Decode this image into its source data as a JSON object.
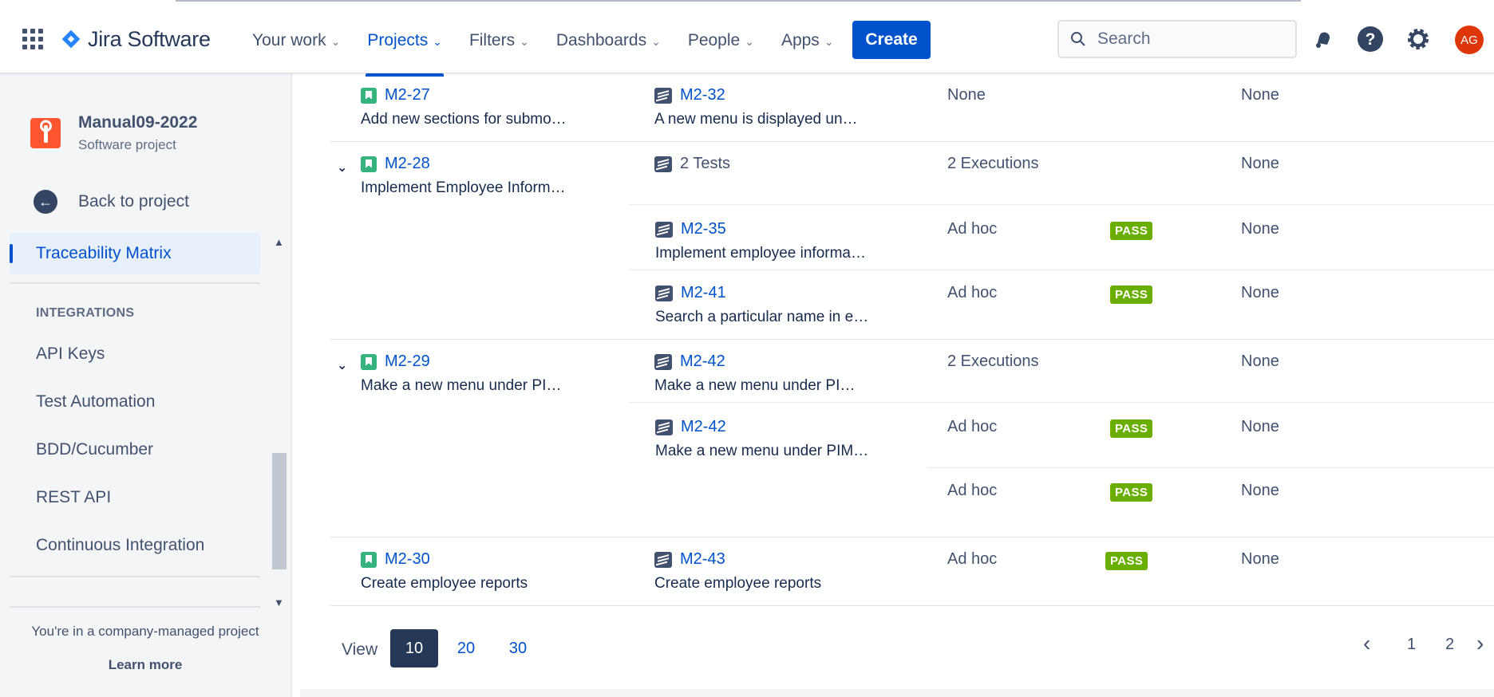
{
  "app": {
    "name": "Jira Software"
  },
  "nav": {
    "items": [
      {
        "label": "Your work"
      },
      {
        "label": "Projects"
      },
      {
        "label": "Filters"
      },
      {
        "label": "Dashboards"
      },
      {
        "label": "People"
      },
      {
        "label": "Apps"
      }
    ],
    "active": "Projects",
    "create_label": "Create"
  },
  "search": {
    "placeholder": "Search"
  },
  "user": {
    "initials": "AG"
  },
  "sidebar": {
    "project_name": "Manual09-2022",
    "project_type": "Software project",
    "back_label": "Back to project",
    "active_item": "Traceability Matrix",
    "section_heading": "INTEGRATIONS",
    "integration_items": [
      "API Keys",
      "Test Automation",
      "BDD/Cucumber",
      "REST API",
      "Continuous Integration"
    ],
    "footer_message": "You're in a company-managed project",
    "footer_link": "Learn more"
  },
  "matrix": {
    "rows": [
      {
        "key": "M2-27",
        "summary": "Add new sections for submo…",
        "test_key": "M2-32",
        "test_summary": "A new menu is displayed un…",
        "execution": "None",
        "defects": "None"
      },
      {
        "key": "M2-28",
        "summary": "Implement Employee Inform…",
        "tests_count": "2 Tests",
        "executions_count": "2 Executions",
        "defects": "None",
        "children": [
          {
            "test_key": "M2-35",
            "test_summary": "Implement employee informa…",
            "execution": "Ad hoc",
            "status": "PASS",
            "defects": "None"
          },
          {
            "test_key": "M2-41",
            "test_summary": "Search a particular name in e…",
            "execution": "Ad hoc",
            "status": "PASS",
            "defects": "None"
          }
        ]
      },
      {
        "key": "M2-29",
        "summary": "Make a new menu under PI…",
        "test_key": "M2-42",
        "test_summary": "Make a new menu under PI…",
        "executions_count": "2 Executions",
        "defects": "None",
        "children": [
          {
            "test_key": "M2-42",
            "test_summary": "Make a new menu under PIM…",
            "execution": "Ad hoc",
            "status": "PASS",
            "defects": "None"
          },
          {
            "execution": "Ad hoc",
            "status": "PASS",
            "defects": "None"
          }
        ]
      },
      {
        "key": "M2-30",
        "summary": "Create employee reports",
        "test_key": "M2-43",
        "test_summary": "Create employee reports",
        "execution": "Ad hoc",
        "status": "PASS",
        "defects": "None"
      }
    ]
  },
  "pager": {
    "view_label": "View",
    "sizes": [
      "10",
      "20",
      "30"
    ],
    "selected_size": "10",
    "pages": [
      "1",
      "2"
    ],
    "prev_icon": "‹",
    "next_icon": "›"
  }
}
